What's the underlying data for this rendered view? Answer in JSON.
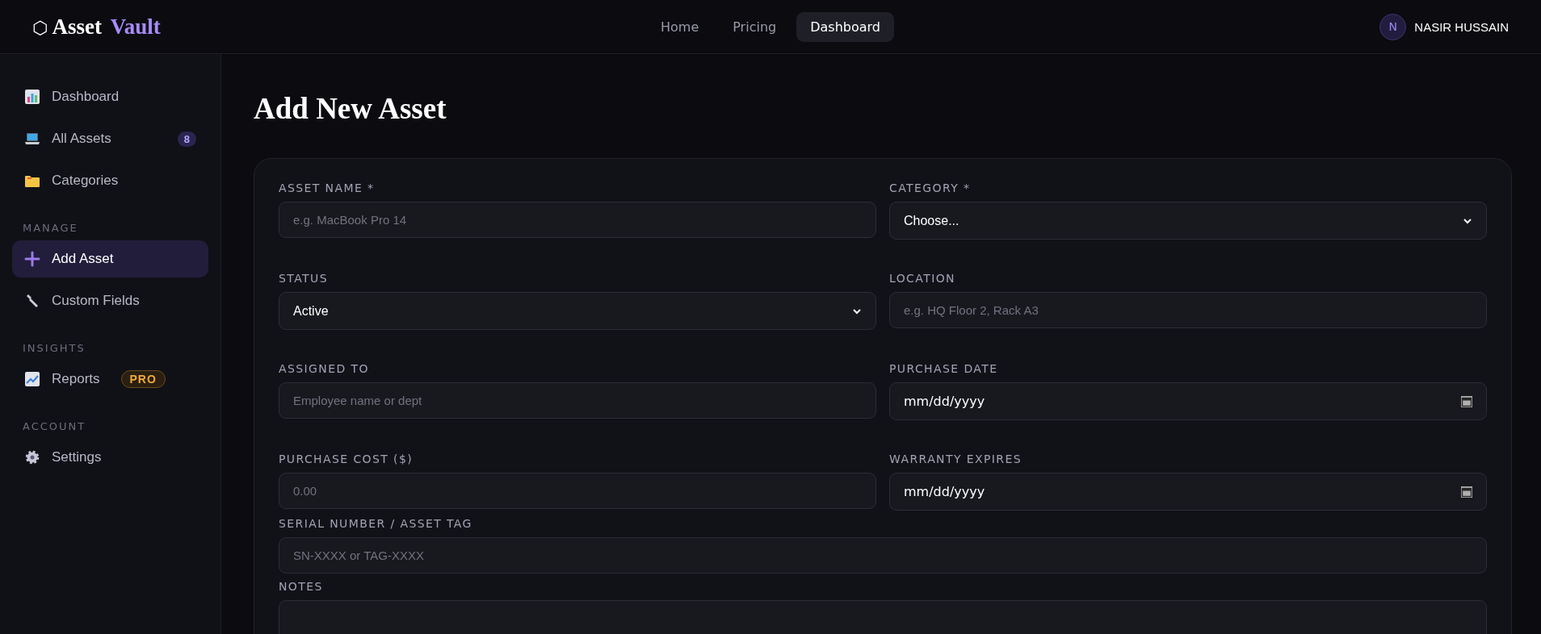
{
  "brand": {
    "mark": "⬡",
    "name": "Asset",
    "accent": "Vault"
  },
  "nav": [
    {
      "label": "Home",
      "selected": false
    },
    {
      "label": "Pricing",
      "selected": false
    },
    {
      "label": "Dashboard",
      "selected": true
    }
  ],
  "user": {
    "initial": "N",
    "name": "NASIR HUSSAIN"
  },
  "sidebar": {
    "sections": [
      {
        "items": [
          {
            "label": "Dashboard",
            "kind": "bars",
            "selected": false
          },
          {
            "label": "All Assets",
            "kind": "laptop",
            "selected": false,
            "count": "8"
          },
          {
            "label": "Categories",
            "kind": "folder",
            "selected": false
          }
        ]
      },
      {
        "heading": "MANAGE",
        "items": [
          {
            "label": "Add Asset",
            "kind": "plus",
            "selected": true
          },
          {
            "label": "Custom Fields",
            "kind": "wrench",
            "selected": false
          }
        ]
      },
      {
        "heading": "INSIGHTS",
        "items": [
          {
            "label": "Reports",
            "kind": "trend",
            "selected": false,
            "tag": "PRO"
          }
        ]
      },
      {
        "heading": "ACCOUNT",
        "items": [
          {
            "label": "Settings",
            "kind": "gear",
            "selected": false
          }
        ]
      }
    ]
  },
  "page_title": "Add New Asset",
  "form": {
    "fields": [
      {
        "label": "ASSET NAME *",
        "kind": "text",
        "placeholder": "e.g. MacBook Pro 14"
      },
      {
        "label": "CATEGORY *",
        "kind": "select",
        "value": "Choose..."
      },
      {
        "label": "STATUS",
        "kind": "select",
        "value": "Active"
      },
      {
        "label": "LOCATION",
        "kind": "text",
        "placeholder": "e.g. HQ Floor 2, Rack A3"
      },
      {
        "label": "ASSIGNED TO",
        "kind": "text",
        "placeholder": "Employee name or dept"
      },
      {
        "label": "PURCHASE DATE",
        "kind": "date",
        "value": "mm/dd/yyyy"
      },
      {
        "label": "PURCHASE COST ($)",
        "kind": "text",
        "placeholder": "0.00"
      },
      {
        "label": "WARRANTY EXPIRES",
        "kind": "date",
        "value": "mm/dd/yyyy"
      },
      {
        "label": "SERIAL NUMBER / ASSET TAG",
        "kind": "wide-text",
        "placeholder": "SN-XXXX or TAG-XXXX"
      },
      {
        "label": "NOTES",
        "kind": "textarea"
      }
    ]
  }
}
